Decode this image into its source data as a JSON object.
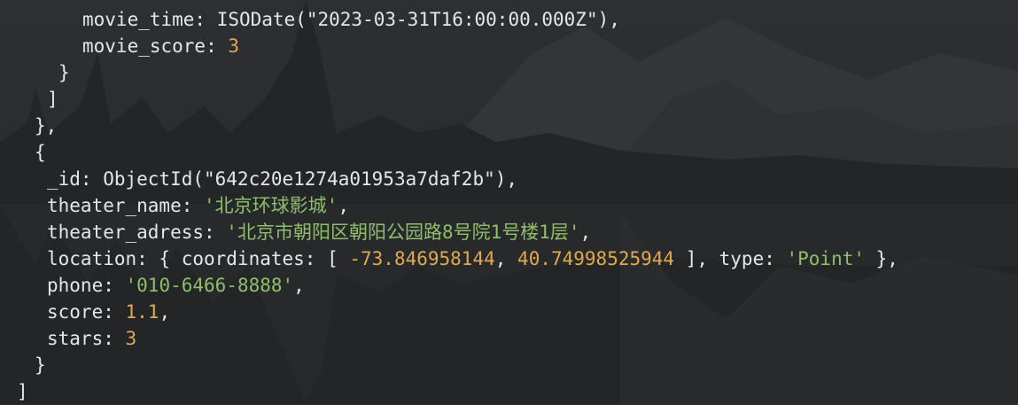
{
  "terminal": {
    "lines": [
      {
        "indent": 3,
        "segments": [
          {
            "cls": "k",
            "text": "movie_time: "
          },
          {
            "cls": "p",
            "text": "ISODate(\"2023-03-31T16:00:00.000Z\"),"
          }
        ]
      },
      {
        "indent": 3,
        "segments": [
          {
            "cls": "k",
            "text": "movie_score: "
          },
          {
            "cls": "num",
            "text": "3"
          }
        ]
      },
      {
        "indent": 2,
        "segments": [
          {
            "cls": "p",
            "text": "}"
          }
        ]
      },
      {
        "indent": 1.5,
        "segments": [
          {
            "cls": "p",
            "text": "]"
          }
        ]
      },
      {
        "indent": 1,
        "segments": [
          {
            "cls": "p",
            "text": "},"
          }
        ]
      },
      {
        "indent": 1,
        "segments": [
          {
            "cls": "p",
            "text": "{"
          }
        ]
      },
      {
        "indent": 1.5,
        "segments": [
          {
            "cls": "k",
            "text": "_id: "
          },
          {
            "cls": "p",
            "text": "ObjectId(\"642c20e1274a01953a7daf2b\"),"
          }
        ]
      },
      {
        "indent": 1.5,
        "segments": [
          {
            "cls": "k",
            "text": "theater_name: "
          },
          {
            "cls": "str",
            "text": "'北京环球影城'"
          },
          {
            "cls": "p",
            "text": ","
          }
        ]
      },
      {
        "indent": 1.5,
        "segments": [
          {
            "cls": "k",
            "text": "theater_adress: "
          },
          {
            "cls": "str",
            "text": "'北京市朝阳区朝阳公园路8号院1号楼1层'"
          },
          {
            "cls": "p",
            "text": ","
          }
        ]
      },
      {
        "indent": 1.5,
        "segments": [
          {
            "cls": "k",
            "text": "location: { coordinates: [ "
          },
          {
            "cls": "num",
            "text": "-73.846958144"
          },
          {
            "cls": "p",
            "text": ", "
          },
          {
            "cls": "num",
            "text": "40.74998525944"
          },
          {
            "cls": "p",
            "text": " ], type: "
          },
          {
            "cls": "str",
            "text": "'Point'"
          },
          {
            "cls": "p",
            "text": " },"
          }
        ]
      },
      {
        "indent": 1.5,
        "segments": [
          {
            "cls": "k",
            "text": "phone: "
          },
          {
            "cls": "str",
            "text": "'010-6466-8888'"
          },
          {
            "cls": "p",
            "text": ","
          }
        ]
      },
      {
        "indent": 1.5,
        "segments": [
          {
            "cls": "k",
            "text": "score: "
          },
          {
            "cls": "num",
            "text": "1.1"
          },
          {
            "cls": "p",
            "text": ","
          }
        ]
      },
      {
        "indent": 1.5,
        "segments": [
          {
            "cls": "k",
            "text": "stars: "
          },
          {
            "cls": "num",
            "text": "3"
          }
        ]
      },
      {
        "indent": 1,
        "segments": [
          {
            "cls": "p",
            "text": "}"
          }
        ]
      },
      {
        "indent": 0.25,
        "segments": [
          {
            "cls": "p",
            "text": "]"
          }
        ]
      }
    ]
  },
  "colors": {
    "background": "#2b2c2e",
    "text": "#e6e6e6",
    "number": "#e0a94f",
    "string": "#8fbf6a"
  }
}
